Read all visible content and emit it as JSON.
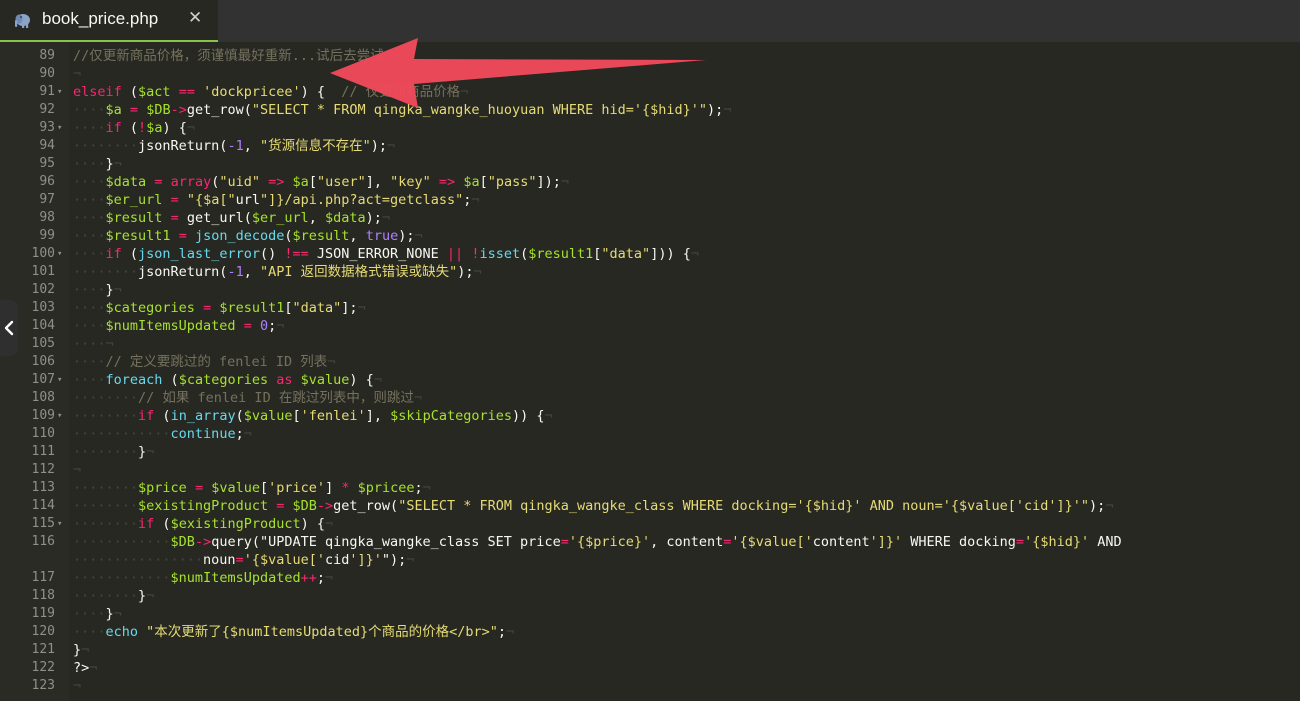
{
  "tab": {
    "filename": "book_price.php",
    "close_glyph": "✕",
    "icon": "elephant-icon"
  },
  "colors": {
    "background": "#272822",
    "tab_accent": "#8bc34a",
    "arrow": "#f04a5a"
  },
  "line_numbers": [
    "89",
    "90",
    "91",
    "92",
    "93",
    "94",
    "95",
    "96",
    "97",
    "98",
    "99",
    "100",
    "101",
    "102",
    "103",
    "104",
    "105",
    "106",
    "107",
    "108",
    "109",
    "110",
    "111",
    "112",
    "113",
    "114",
    "115",
    "116",
    "",
    "117",
    "118",
    "119",
    "120",
    "121",
    "122",
    "123"
  ],
  "fold_markers": {
    "91": "▾",
    "93": "▾",
    "100": "▾",
    "107": "▾",
    "109": "▾",
    "115": "▾"
  },
  "lines": [
    "//仅更新商品价格，须谨慎最好重新...试后去尝试",
    "¬",
    "elseif ($act == 'dockpricee') {  // 仅更新商品价格¬",
    "····$a = $DB->get_row(\"SELECT * FROM qingka_wangke_huoyuan WHERE hid='{$hid}'\");¬",
    "····if (!$a) {¬",
    "········jsonReturn(-1, \"货源信息不存在\");¬",
    "····}¬",
    "····$data = array(\"uid\" => $a[\"user\"], \"key\" => $a[\"pass\"]);¬",
    "····$er_url = \"{$a[\"url\"]}/api.php?act=getclass\";¬",
    "····$result = get_url($er_url, $data);¬",
    "····$result1 = json_decode($result, true);¬",
    "····if (json_last_error() !== JSON_ERROR_NONE || !isset($result1[\"data\"])) {¬",
    "········jsonReturn(-1, \"API 返回数据格式错误或缺失\");¬",
    "····}¬",
    "····$categories = $result1[\"data\"];¬",
    "····$numItemsUpdated = 0;¬",
    "····¬",
    "····// 定义要跳过的 fenlei ID 列表¬",
    "····foreach ($categories as $value) {¬",
    "········// 如果 fenlei ID 在跳过列表中，则跳过¬",
    "········if (in_array($value['fenlei'], $skipCategories)) {¬",
    "············continue;¬",
    "········}¬",
    "¬",
    "········$price = $value['price'] * $pricee;¬",
    "········$existingProduct = $DB->get_row(\"SELECT * FROM qingka_wangke_class WHERE docking='{$hid}' AND noun='{$value['cid']}'\");¬",
    "········if ($existingProduct) {¬",
    "············$DB->query(\"UPDATE qingka_wangke_class SET price='{$price}', content='{$value['content']}' WHERE docking='{$hid}' AND",
    "················noun='{$value['cid']}'\");¬",
    "············$numItemsUpdated++;¬",
    "········}¬",
    "····}¬",
    "····echo \"本次更新了{$numItemsUpdated}个商品的价格</br>\";¬",
    "}¬",
    "?>¬",
    "¬"
  ]
}
